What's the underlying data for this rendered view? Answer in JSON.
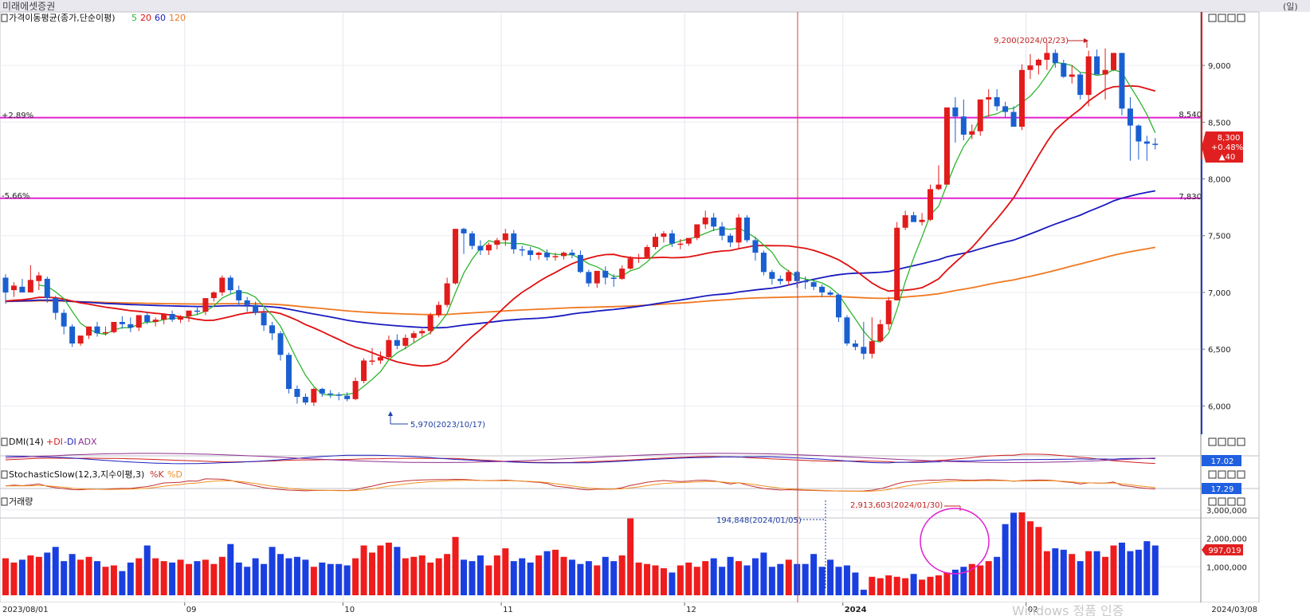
{
  "header": {
    "title": "미래에셋증권",
    "period": "(일)"
  },
  "panels": {
    "price": {
      "label": "가격이동평균(종가,단순이평)",
      "ma_periods": [
        "5",
        "20",
        "60",
        "120"
      ],
      "ma_colors": [
        "#2fb52f",
        "#e01010",
        "#1a1ac0",
        "#f07820"
      ]
    },
    "dmi": {
      "label": "DMI(14)",
      "series": [
        "+DI",
        "-DI",
        "ADX"
      ],
      "value": "17.02",
      "colors": [
        "#d02020",
        "#2020c0",
        "#903090"
      ]
    },
    "stochastic": {
      "label": "StochasticSlow(12,3,지수이평,3)",
      "series": [
        "%K",
        "%D"
      ],
      "value": "17.29",
      "colors": [
        "#c03030",
        "#f09020"
      ]
    },
    "volume": {
      "label": "거래량",
      "value": "997,019"
    }
  },
  "price_axis": {
    "ticks": [
      "9,000",
      "8,500",
      "8,000",
      "7,500",
      "7,000",
      "6,500",
      "6,000"
    ],
    "current_price": "8,300",
    "current_change_pct": "+0.48%",
    "current_change": "▲40"
  },
  "volume_axis": {
    "ticks": [
      "3,000,000",
      "2,000,000",
      "1,000,000"
    ]
  },
  "x_axis": {
    "start_label": "2023/08/01",
    "end_label": "2024/03/08",
    "month_labels": [
      "09",
      "10",
      "11",
      "12",
      "2024",
      "02",
      "03"
    ]
  },
  "annotations": {
    "high": "9,200(2024/02/23)",
    "low": "5,970(2023/10/17)",
    "upper_line_pct": "+2.89%",
    "upper_line_value": "8,540",
    "lower_line_pct": "-5.66%",
    "lower_line_value": "7,830",
    "vol_max": "2,913,603(2024/01/30)",
    "vol_min": "194,848(2024/01/05)"
  },
  "watermark": "Windows 정품 인증",
  "chart_data": {
    "type": "candlestick",
    "title": "",
    "xlabel": "",
    "ylabel": "",
    "ylim": [
      5750,
      9450
    ],
    "volume_ylim": [
      0,
      3500000
    ],
    "hlines": [
      8540,
      7830
    ],
    "dates": [
      "2023/08/01",
      "2023/08/02",
      "2023/08/03",
      "2023/08/04",
      "2023/08/07",
      "2023/08/08",
      "2023/08/09",
      "2023/08/10",
      "2023/08/11",
      "2023/08/14",
      "2023/08/16",
      "2023/08/17",
      "2023/08/18",
      "2023/08/21",
      "2023/08/22",
      "2023/08/23",
      "2023/08/24",
      "2023/08/25",
      "2023/08/28",
      "2023/08/29",
      "2023/08/30",
      "2023/08/31",
      "2023/09/01",
      "2023/09/04",
      "2023/09/05",
      "2023/09/06",
      "2023/09/07",
      "2023/09/08",
      "2023/09/11",
      "2023/09/12",
      "2023/09/13",
      "2023/09/14",
      "2023/09/15",
      "2023/09/18",
      "2023/09/19",
      "2023/09/20",
      "2023/09/21",
      "2023/09/22",
      "2023/09/25",
      "2023/09/26",
      "2023/09/27",
      "2023/10/04",
      "2023/10/05",
      "2023/10/06",
      "2023/10/10",
      "2023/10/11",
      "2023/10/12",
      "2023/10/13",
      "2023/10/16",
      "2023/10/17",
      "2023/10/18",
      "2023/10/19",
      "2023/10/20",
      "2023/10/23",
      "2023/10/24",
      "2023/10/25",
      "2023/10/26",
      "2023/10/27",
      "2023/10/30",
      "2023/10/31",
      "2023/11/01",
      "2023/11/02",
      "2023/11/03",
      "2023/11/06",
      "2023/11/07",
      "2023/11/08",
      "2023/11/09",
      "2023/11/10",
      "2023/11/13",
      "2023/11/14",
      "2023/11/15",
      "2023/11/16",
      "2023/11/17",
      "2023/11/20",
      "2023/11/21",
      "2023/11/22",
      "2023/11/23",
      "2023/11/24",
      "2023/11/27",
      "2023/11/28",
      "2023/11/29",
      "2023/11/30",
      "2023/12/01",
      "2023/12/04",
      "2023/12/05",
      "2023/12/06",
      "2023/12/07",
      "2023/12/08",
      "2023/12/11",
      "2023/12/12",
      "2023/12/13",
      "2023/12/14",
      "2023/12/15",
      "2023/12/18",
      "2023/12/19",
      "2023/12/20",
      "2023/12/21",
      "2023/12/22",
      "2023/12/26",
      "2023/12/27",
      "2023/12/28",
      "2024/01/02",
      "2024/01/03",
      "2024/01/04",
      "2024/01/05",
      "2024/01/08",
      "2024/01/09",
      "2024/01/10",
      "2024/01/11",
      "2024/01/12",
      "2024/01/15",
      "2024/01/16",
      "2024/01/17",
      "2024/01/18",
      "2024/01/19",
      "2024/01/22",
      "2024/01/23",
      "2024/01/24",
      "2024/01/25",
      "2024/01/26",
      "2024/01/29",
      "2024/01/30",
      "2024/01/31",
      "2024/02/01",
      "2024/02/02",
      "2024/02/05",
      "2024/02/06",
      "2024/02/07",
      "2024/02/08",
      "2024/02/13",
      "2024/02/14",
      "2024/02/15",
      "2024/02/16",
      "2024/02/19",
      "2024/02/20",
      "2024/02/21",
      "2024/02/22",
      "2024/02/23",
      "2024/02/26",
      "2024/02/27",
      "2024/02/28",
      "2024/02/29",
      "2024/03/04",
      "2024/03/05",
      "2024/03/06",
      "2024/03/07",
      "2024/03/08"
    ],
    "candles": {
      "open": [
        7130,
        7020,
        7050,
        7000,
        7100,
        7120,
        6950,
        6820,
        6700,
        6550,
        6620,
        6700,
        6640,
        6650,
        6740,
        6720,
        6690,
        6800,
        6740,
        6760,
        6810,
        6760,
        6790,
        6840,
        6830,
        6950,
        7000,
        7130,
        7020,
        6930,
        6890,
        6820,
        6710,
        6640,
        6450,
        6150,
        6080,
        6030,
        6150,
        6110,
        6100,
        6090,
        6060,
        6220,
        6400,
        6400,
        6430,
        6580,
        6530,
        6600,
        6640,
        6660,
        6800,
        6890,
        7080,
        7560,
        7520,
        7410,
        7370,
        7420,
        7460,
        7520,
        7380,
        7370,
        7330,
        7350,
        7310,
        7320,
        7350,
        7330,
        7180,
        7080,
        7190,
        7130,
        7120,
        7210,
        7300,
        7310,
        7400,
        7490,
        7520,
        7430,
        7430,
        7480,
        7600,
        7660,
        7580,
        7500,
        7440,
        7660,
        7460,
        7350,
        7180,
        7120,
        7100,
        7180,
        7100,
        7090,
        7050,
        7000,
        6980,
        6780,
        6550,
        6520,
        6460,
        6570,
        6720,
        6930,
        7570,
        7680,
        7620,
        7640,
        7910,
        7950,
        8630,
        8550,
        8390,
        8420,
        8700,
        8720,
        8640,
        8590,
        8460,
        8960,
        9000,
        9050,
        9110,
        9020,
        8900,
        8920,
        8740,
        9080,
        8920,
        8960,
        9110,
        8620,
        8470,
        8330,
        8310
      ],
      "high": [
        7160,
        7090,
        7120,
        7240,
        7180,
        7140,
        6970,
        6850,
        6720,
        6600,
        6680,
        6740,
        6700,
        6720,
        6790,
        6780,
        6760,
        6830,
        6780,
        6810,
        6840,
        6800,
        6840,
        6880,
        6870,
        7010,
        7150,
        7150,
        7060,
        6960,
        6920,
        6860,
        6740,
        6660,
        6470,
        6180,
        6110,
        6160,
        6160,
        6140,
        6120,
        6120,
        6250,
        6420,
        6510,
        6480,
        6620,
        6630,
        6630,
        6660,
        6680,
        6820,
        6920,
        7130,
        7560,
        7570,
        7540,
        7460,
        7440,
        7480,
        7560,
        7550,
        7410,
        7400,
        7360,
        7380,
        7350,
        7360,
        7380,
        7370,
        7200,
        7130,
        7230,
        7160,
        7240,
        7320,
        7340,
        7420,
        7520,
        7540,
        7550,
        7470,
        7470,
        7600,
        7720,
        7700,
        7620,
        7520,
        7690,
        7680,
        7490,
        7370,
        7200,
        7150,
        7200,
        7190,
        7140,
        7100,
        7070,
        7020,
        6990,
        6800,
        6580,
        6740,
        6780,
        6760,
        6960,
        7620,
        7720,
        7710,
        7700,
        7950,
        8120,
        8550,
        8720,
        8700,
        8480,
        8620,
        8790,
        8790,
        8680,
        8640,
        9010,
        9100,
        9060,
        9200,
        9140,
        9050,
        9000,
        8940,
        9130,
        9140,
        9150,
        9110,
        9010,
        8720,
        8480,
        8380,
        8360
      ],
      "low": [
        6900,
        6960,
        7000,
        7000,
        7020,
        6910,
        6760,
        6630,
        6520,
        6530,
        6590,
        6610,
        6620,
        6640,
        6680,
        6650,
        6660,
        6720,
        6700,
        6720,
        6740,
        6730,
        6740,
        6800,
        6800,
        6920,
        6970,
        6990,
        6880,
        6830,
        6800,
        6660,
        6580,
        6400,
        6110,
        6020,
        6010,
        6000,
        6080,
        6070,
        6050,
        6040,
        6050,
        6200,
        6360,
        6370,
        6410,
        6500,
        6500,
        6560,
        6610,
        6630,
        6780,
        6870,
        7070,
        7340,
        7380,
        7330,
        7330,
        7380,
        7410,
        7340,
        7320,
        7280,
        7290,
        7280,
        7280,
        7290,
        7300,
        7170,
        7050,
        7040,
        7070,
        7050,
        7110,
        7200,
        7260,
        7300,
        7380,
        7440,
        7400,
        7380,
        7410,
        7460,
        7560,
        7540,
        7460,
        7400,
        7380,
        7440,
        7280,
        7150,
        7070,
        7070,
        7060,
        7040,
        7030,
        7020,
        6960,
        6970,
        6740,
        6530,
        6490,
        6410,
        6420,
        6560,
        6670,
        6930,
        7550,
        7640,
        7590,
        7630,
        7900,
        7950,
        8320,
        8340,
        8350,
        8380,
        8550,
        8600,
        8540,
        8580,
        8430,
        8880,
        8920,
        8960,
        8980,
        8890,
        8840,
        8700,
        8640,
        9000,
        8700,
        8950,
        8560,
        8160,
        8170,
        8160,
        8260
      ],
      "close": [
        7000,
        7060,
        7000,
        7110,
        7150,
        6950,
        6820,
        6700,
        6550,
        6620,
        6700,
        6640,
        6650,
        6740,
        6720,
        6690,
        6800,
        6740,
        6760,
        6810,
        6760,
        6790,
        6840,
        6830,
        6950,
        7000,
        7130,
        7020,
        6930,
        6890,
        6820,
        6710,
        6640,
        6450,
        6150,
        6080,
        6030,
        6150,
        6110,
        6100,
        6090,
        6060,
        6220,
        6400,
        6400,
        6430,
        6580,
        6530,
        6600,
        6640,
        6660,
        6800,
        6890,
        7080,
        7560,
        7520,
        7410,
        7370,
        7420,
        7460,
        7520,
        7380,
        7370,
        7330,
        7350,
        7310,
        7320,
        7350,
        7330,
        7180,
        7080,
        7190,
        7130,
        7120,
        7210,
        7300,
        7310,
        7400,
        7490,
        7520,
        7430,
        7430,
        7480,
        7600,
        7660,
        7580,
        7500,
        7440,
        7660,
        7460,
        7350,
        7180,
        7120,
        7100,
        7180,
        7100,
        7090,
        7050,
        7000,
        6980,
        6780,
        6550,
        6520,
        6460,
        6570,
        6720,
        6930,
        7570,
        7680,
        7620,
        7640,
        7910,
        7950,
        8630,
        8550,
        8390,
        8420,
        8700,
        8720,
        8640,
        8590,
        8460,
        8960,
        9000,
        9050,
        9110,
        9020,
        8900,
        8920,
        8740,
        9080,
        8920,
        8960,
        9110,
        8620,
        8470,
        8330,
        8310,
        8300
      ]
    },
    "volume": [
      1300000,
      1150000,
      1250000,
      1400000,
      1350000,
      1500000,
      1700000,
      1200000,
      1450000,
      1250000,
      1350000,
      1200000,
      1000000,
      1050000,
      850000,
      1150000,
      1300000,
      1750000,
      1300000,
      1200000,
      1150000,
      1250000,
      1100000,
      1200000,
      1250000,
      1100000,
      1350000,
      1800000,
      1150000,
      1000000,
      1300000,
      1100000,
      1700000,
      1450000,
      1300000,
      1350000,
      1250000,
      1000000,
      1150000,
      1100000,
      1100000,
      1050000,
      1300000,
      1750000,
      1500000,
      1750000,
      1850000,
      1700000,
      1300000,
      1350000,
      1400000,
      1150000,
      1300000,
      1450000,
      2050000,
      1250000,
      1200000,
      1400000,
      1050000,
      1400000,
      1650000,
      1200000,
      1300000,
      1150000,
      1400000,
      1550000,
      1600000,
      1350000,
      1250000,
      1100000,
      1200000,
      1050000,
      1350000,
      1200000,
      1400000,
      2700000,
      1150000,
      1100000,
      1050000,
      950000,
      800000,
      1050000,
      1150000,
      1000000,
      1200000,
      1300000,
      1000000,
      1350000,
      1200000,
      1050000,
      1300000,
      1500000,
      1000000,
      1100000,
      1250000,
      1100000,
      1100000,
      1450000,
      1000000,
      1250000,
      1000000,
      1050000,
      800000,
      194848,
      650000,
      600000,
      700000,
      650000,
      600000,
      750000,
      550000,
      650000,
      700000,
      800000,
      900000,
      1000000,
      1100000,
      1050000,
      1200000,
      1350000,
      2500000,
      2900000,
      2913603,
      2600000,
      2400000,
      1550000,
      1650000,
      1600000,
      1450000,
      1200000,
      1550000,
      1550000,
      1350000,
      1750000,
      1850000,
      1550000,
      1600000,
      1900000,
      1750000,
      1550000,
      1600000,
      1800000,
      1650000,
      1700000,
      1650000,
      2050000,
      1250000,
      997019
    ]
  }
}
